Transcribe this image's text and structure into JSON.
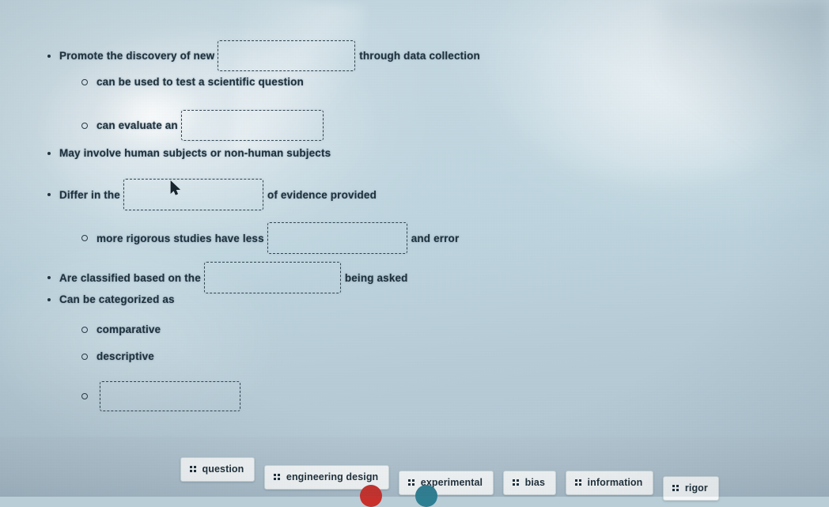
{
  "document": {
    "type": "fill-in-the-blank worksheet",
    "lines": [
      {
        "id": "line-1",
        "marker": "bullet-dot",
        "indent": 0,
        "before": "Promote the discovery of new",
        "blank": true,
        "after": "through data collection"
      },
      {
        "id": "line-2",
        "marker": "bullet-ring",
        "indent": 1,
        "before": "can be used to test a scientific question",
        "blank": false,
        "after": ""
      },
      {
        "id": "line-3",
        "marker": "bullet-ring",
        "indent": 1,
        "before": "can evaluate an",
        "blank": true,
        "after": ""
      },
      {
        "id": "line-4",
        "marker": "bullet-dot",
        "indent": 0,
        "before": "May involve human subjects or non-human subjects",
        "blank": false,
        "after": ""
      },
      {
        "id": "line-5",
        "marker": "bullet-dot",
        "indent": 0,
        "before": "Differ in the",
        "blank": true,
        "after": "of evidence provided"
      },
      {
        "id": "line-6",
        "marker": "bullet-ring",
        "indent": 1,
        "before": "more rigorous studies have less",
        "blank": true,
        "after": "and error"
      },
      {
        "id": "line-7",
        "marker": "bullet-dot",
        "indent": 0,
        "before": "Are classified based on the",
        "blank": true,
        "after": "being asked"
      },
      {
        "id": "line-8",
        "marker": "bullet-dot",
        "indent": 0,
        "before": "Can be categorized as",
        "blank": false,
        "after": ""
      },
      {
        "id": "line-9",
        "marker": "bullet-ring",
        "indent": 1,
        "before": "comparative",
        "blank": false,
        "after": ""
      },
      {
        "id": "line-10",
        "marker": "bullet-ring",
        "indent": 1,
        "before": "descriptive",
        "blank": false,
        "after": ""
      },
      {
        "id": "line-11",
        "marker": "bullet-ring",
        "indent": 1,
        "before": "",
        "blank": true,
        "after": ""
      }
    ]
  },
  "tray": {
    "drag_icon": "drag-handle-grid-icon",
    "tiles": [
      {
        "label": "question"
      },
      {
        "label": "engineering design"
      },
      {
        "label": "experimental"
      },
      {
        "label": "bias"
      },
      {
        "label": "information"
      },
      {
        "label": "rigor"
      }
    ]
  },
  "decoration": {
    "cursor": "mouse-pointer-arrow",
    "bottom_dots": [
      {
        "name": "red-dot",
        "color": "#c8302b"
      },
      {
        "name": "teal-dot",
        "color": "#2f7f93"
      }
    ]
  },
  "colors": {
    "background": "#bed5df",
    "text": "#1e2f3a",
    "dash_border": "#30444f",
    "tile_bg": "#f3f6f7",
    "tray_bg": "#aebdc8"
  }
}
